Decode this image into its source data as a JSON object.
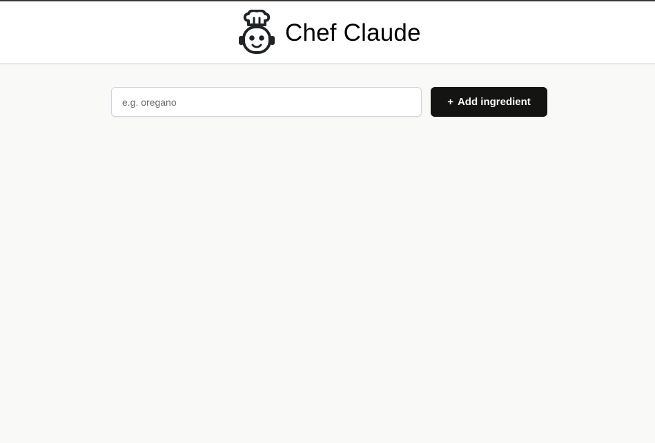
{
  "header": {
    "title": "Chef Claude",
    "logo_icon": "chef-robot-icon"
  },
  "form": {
    "input_placeholder": "e.g. oregano",
    "input_value": "",
    "button_plus": "+",
    "button_label": "Add ingredient"
  },
  "colors": {
    "page_background": "#f9f9f7",
    "header_background": "#ffffff",
    "button_background": "#141413",
    "button_text": "#fafaf8",
    "logo": "#1f2426"
  }
}
